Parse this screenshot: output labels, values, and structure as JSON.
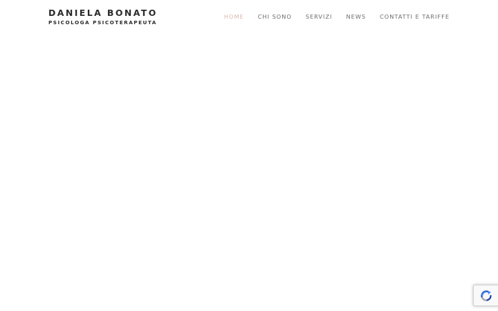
{
  "header": {
    "logo": {
      "name": "DANIELA BONATO",
      "tagline": "PSICOLOGA PSICOTERAPEUTA"
    },
    "nav": [
      {
        "label": "HOME",
        "active": true
      },
      {
        "label": "CHI SONO",
        "active": false
      },
      {
        "label": "SERVIZI",
        "active": false
      },
      {
        "label": "NEWS",
        "active": false
      },
      {
        "label": "CONTATTI E TARIFFE",
        "active": false
      }
    ]
  },
  "recaptcha": {
    "icon": "recaptcha-icon"
  },
  "colors": {
    "background": "#ffffff",
    "logo_text": "#2b2b2b",
    "nav_text": "#6a6a6a",
    "nav_active": "#d8b9ad",
    "recaptcha_blue": "#1c3aa9",
    "recaptcha_light_blue": "#4285f4",
    "recaptcha_gray": "#ababab"
  }
}
